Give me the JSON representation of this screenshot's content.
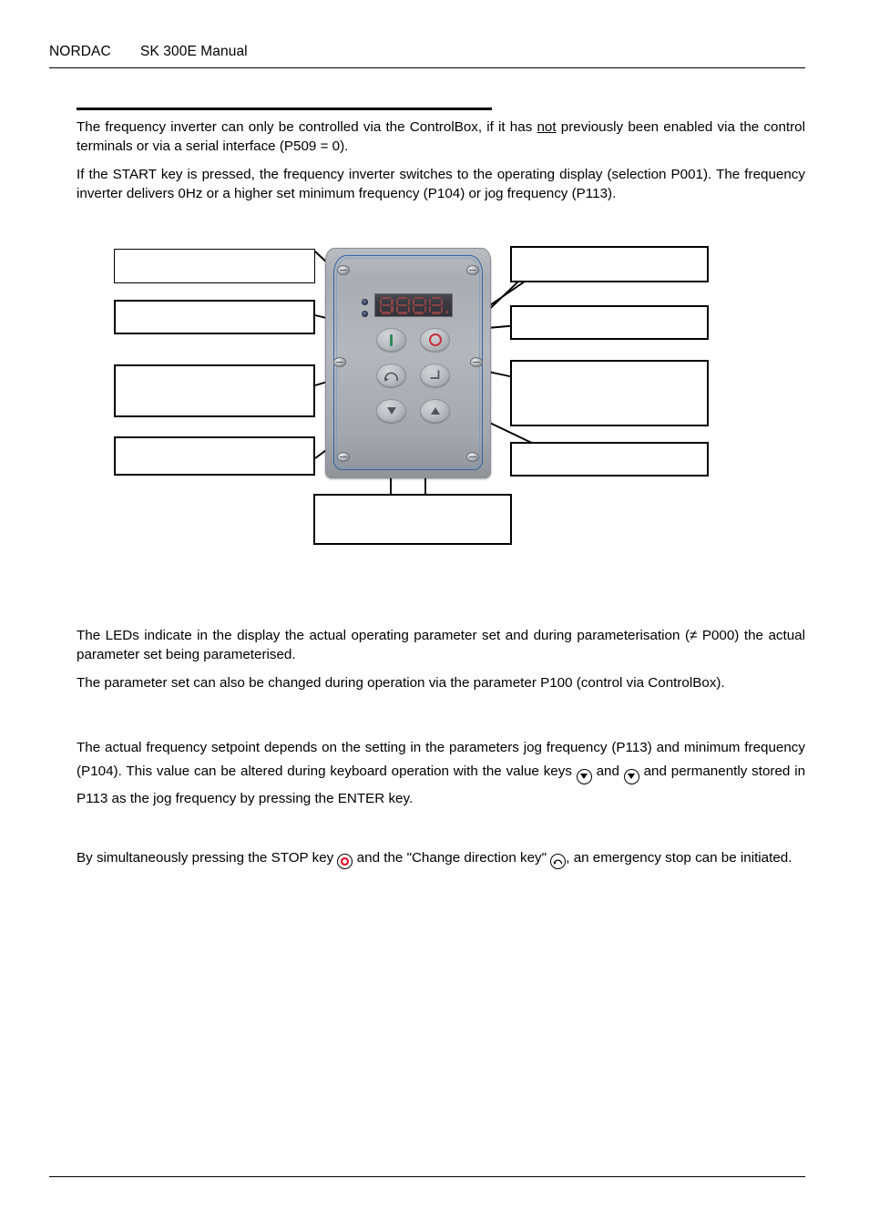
{
  "document": {
    "header": {
      "brand": "NORDAC",
      "title": "SK 300E Manual"
    },
    "footer": {
      "text": ""
    }
  },
  "sections": {
    "intro": {
      "heading": "",
      "paragraph_1_part_a": "The frequency inverter can only be controlled via the ControlBox, if it has ",
      "paragraph_1_emphasis": "not",
      "paragraph_1_part_b": " previously been enabled via the control terminals or via a serial interface (P509 = 0).",
      "paragraph_2": "If the START key is pressed, the frequency inverter switches to the operating display (selection P001). The frequency inverter delivers 0Hz or a higher set minimum frequency (P104) or jog frequency (P113)."
    },
    "leds": {
      "paragraph_1": "The LEDs indicate in the display the actual operating parameter set and during parameterisation (≠ P000) the actual parameter set being parameterised.",
      "paragraph_2": "The parameter set can also be changed during operation via the parameter P100 (control via ControlBox)."
    },
    "setpoint": {
      "part_a": "The actual frequency setpoint depends on the setting in the parameters jog frequency (P113) and minimum frequency (P104). This value can be altered during keyboard operation with the value keys ",
      "part_b": " and ",
      "part_c": " and permanently stored in P113 as the jog frequency by pressing the ENTER key."
    },
    "emergency": {
      "part_a": "By simultaneously pressing the STOP key ",
      "part_b": " and the \"Change direction key\" ",
      "part_c": ", an emergency stop can be initiated."
    }
  },
  "figure": {
    "name": "controlbox-keypad-diagram",
    "device": {
      "label": "ControlBox",
      "display": {
        "type": "7-segment-led",
        "digits": 4,
        "value": ""
      },
      "leds": [
        {
          "name": "parameter-set-led-1"
        },
        {
          "name": "parameter-set-led-2"
        }
      ],
      "keys": [
        {
          "name": "start-key",
          "glyph": "|",
          "color": "#2f8a5c"
        },
        {
          "name": "stop-key",
          "glyph": "O",
          "color": "#c4323a"
        },
        {
          "name": "change-direction-key",
          "glyph": "↻",
          "color": "#50555c"
        },
        {
          "name": "enter-key",
          "glyph": "↵",
          "color": "#50555c"
        },
        {
          "name": "down-key",
          "glyph": "▼",
          "color": "#50555c"
        },
        {
          "name": "up-key",
          "glyph": "▲",
          "color": "#50555c"
        }
      ]
    },
    "callouts": [
      {
        "id": "left-1",
        "text": ""
      },
      {
        "id": "left-2",
        "text": ""
      },
      {
        "id": "left-3",
        "text": ""
      },
      {
        "id": "left-4",
        "text": ""
      },
      {
        "id": "right-1",
        "text": ""
      },
      {
        "id": "right-2",
        "text": ""
      },
      {
        "id": "right-3",
        "text": ""
      },
      {
        "id": "right-4",
        "text": ""
      },
      {
        "id": "bottom-1",
        "text": ""
      }
    ]
  },
  "colors": {
    "ink": "#000000",
    "page": "#ffffff",
    "stop_red": "#e2001a",
    "start_green": "#2f8a5c",
    "trace_blue": "#2f62a8",
    "display_red": "#a24a45"
  }
}
